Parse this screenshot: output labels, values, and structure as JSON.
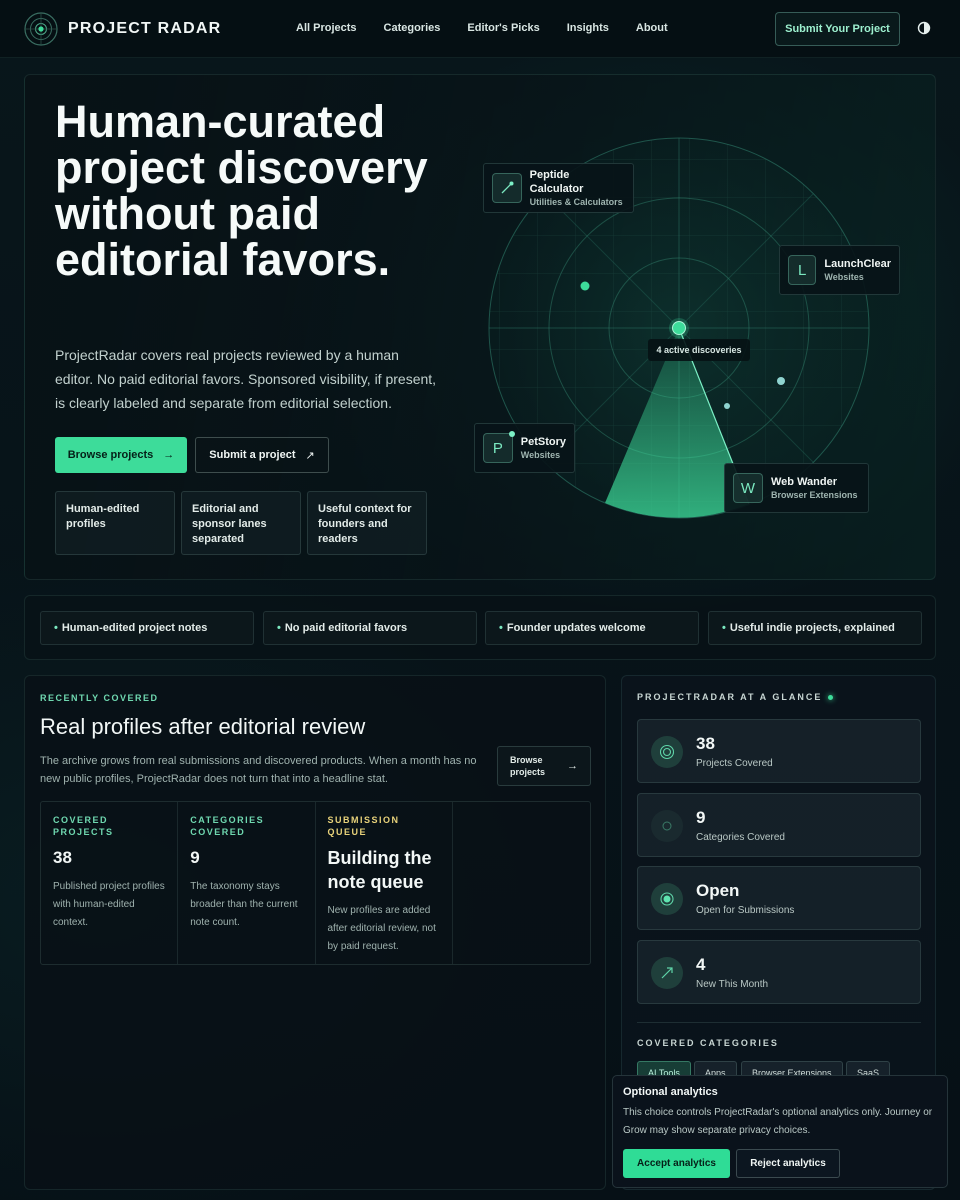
{
  "nav": {
    "brand": "PROJECT RADAR",
    "links": [
      "All Projects",
      "Categories",
      "Editor's Picks",
      "Insights",
      "About"
    ],
    "cta": "Submit Your Project"
  },
  "hero": {
    "title": "Human-curated project discovery without paid editorial favors.",
    "description": "ProjectRadar covers real projects reviewed by a human editor. No paid editorial favors. Sponsored visibility, if present, is clearly labeled and separate from editorial selection.",
    "primary_cta": "Browse projects",
    "secondary_cta": "Submit a project",
    "features": [
      "Human-edited profiles",
      "Editorial and sponsor lanes separated",
      "Useful context for founders and readers"
    ],
    "radar_label": "4 active discoveries",
    "projects": [
      {
        "name": "Peptide Calculator",
        "category": "Utilities & Calculators",
        "icon": "pen-icon"
      },
      {
        "name": "LaunchClear",
        "category": "Websites",
        "icon": "L"
      },
      {
        "name": "PetStory",
        "category": "Websites",
        "icon": "P"
      },
      {
        "name": "Web Wander",
        "category": "Browser Extensions",
        "icon": "W"
      }
    ]
  },
  "strip": [
    "Human-edited project notes",
    "No paid editorial favors",
    "Founder updates welcome",
    "Useful indie projects, explained"
  ],
  "recent": {
    "eyebrow": "RECENTLY COVERED",
    "title": "Real profiles after editorial review",
    "description": "The archive grows from real submissions and discovered products. When a month has no new public profiles, ProjectRadar does not turn that into a headline stat.",
    "browse": "Browse projects",
    "stats": [
      {
        "key": "COVERED PROJECTS",
        "value": "38",
        "desc": "Published project profiles with human-edited context."
      },
      {
        "key": "CATEGORIES COVERED",
        "value": "9",
        "desc": "The taxonomy stays broader than the current note count."
      },
      {
        "key": "SUBMISSION QUEUE",
        "value": "Building the note queue",
        "desc": "New profiles are added after editorial review, not by paid request."
      }
    ]
  },
  "glance": {
    "title": "PROJECTRADAR AT A GLANCE",
    "cards": [
      {
        "value": "38",
        "label": "Projects Covered",
        "icon": "target-icon"
      },
      {
        "value": "9",
        "label": "Categories Covered",
        "icon": "ring-icon"
      },
      {
        "value": "Open",
        "label": "Open for Submissions",
        "icon": "dot-icon"
      },
      {
        "value": "4",
        "label": "New This Month",
        "icon": "arrow-icon"
      }
    ],
    "categories_title": "COVERED CATEGORIES",
    "categories": [
      "AI Tools",
      "Apps",
      "Browser Extensions",
      "SaaS"
    ]
  },
  "cookie": {
    "title": "Optional analytics",
    "text": "This choice controls ProjectRadar's optional analytics only. Journey or Grow may show separate privacy choices.",
    "accept": "Accept analytics",
    "reject": "Reject analytics"
  },
  "colors": {
    "accent": "#3ddc9a",
    "background": "#07141a",
    "highlight": "#e8d27a"
  }
}
